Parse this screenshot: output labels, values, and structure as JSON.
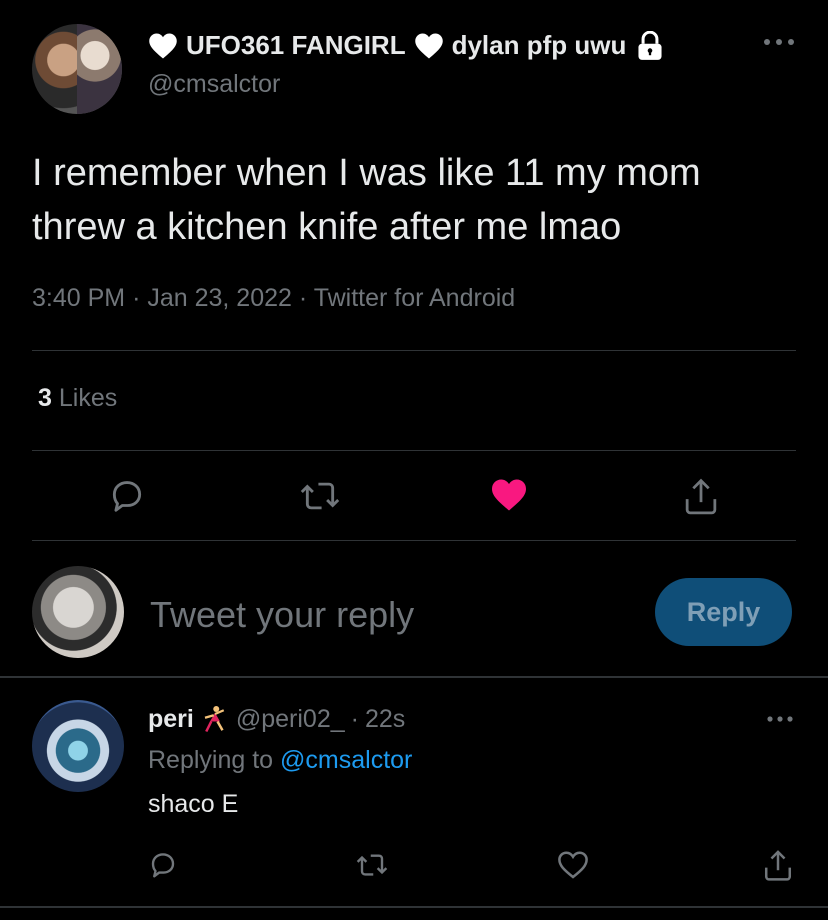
{
  "tweet": {
    "author": {
      "name_part1": "UFO361 FANGIRL",
      "name_part2": "dylan pfp uwu",
      "handle": "@cmsalctor"
    },
    "text": "I remember when I was like 11 my mom threw a kitchen knife after me lmao",
    "time": "3:40 PM",
    "date": "Jan 23, 2022",
    "source": "Twitter for Android",
    "meta_separator": "·",
    "likes_count": "3",
    "likes_label": "Likes",
    "liked": true
  },
  "composer": {
    "placeholder": "Tweet your reply",
    "button_label": "Reply"
  },
  "reply": {
    "name": "peri",
    "handle": "@peri02_",
    "separator": "·",
    "time": "22s",
    "replying_prefix": "Replying to",
    "replying_to": "@cmsalctor",
    "text": "shaco E"
  },
  "icons": {
    "reply": "comment-bubble-icon",
    "retweet": "retweet-icon",
    "like": "heart-icon",
    "share": "share-icon",
    "more": "more-dots-icon",
    "lock": "lock-icon"
  },
  "colors": {
    "background": "#000000",
    "text": "#e7e9ea",
    "muted": "#71767b",
    "like": "#f91880",
    "link": "#1d9bf0",
    "reply_button": "#0f4e78",
    "divider": "#2f3336"
  }
}
